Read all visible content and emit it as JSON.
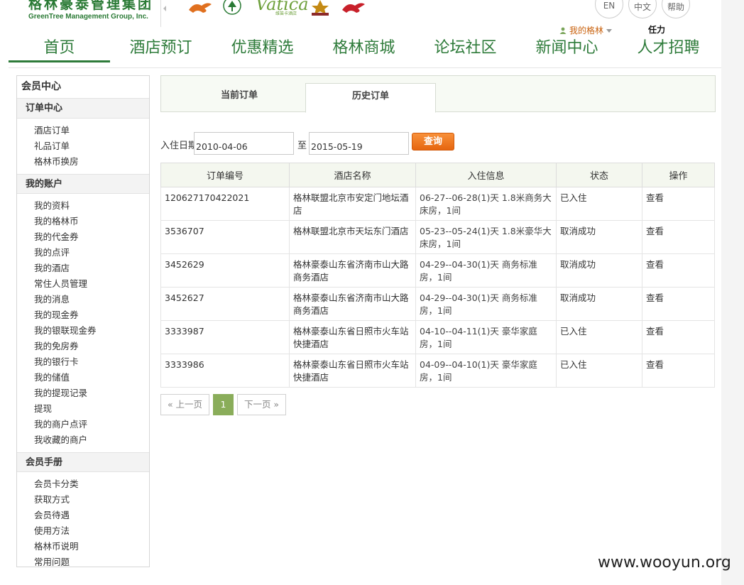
{
  "header": {
    "logo_cn": "格林豪泰管理集团",
    "logo_en": "GreenTree Management Group, Inc.",
    "brand_vatica": "Vatica",
    "brand_vatica_sub": "维笛卡酒店",
    "lang_en": "EN",
    "lang_cn": "中文",
    "help": "帮助",
    "user_menu": "我的格林",
    "user_name": "任力"
  },
  "nav": {
    "items": [
      "首页",
      "酒店预订",
      "优惠精选",
      "格林商城",
      "论坛社区",
      "新闻中心",
      "人才招聘"
    ],
    "active_index": 0
  },
  "sidebar": {
    "title": "会员中心",
    "sections": [
      {
        "title": "订单中心",
        "items": [
          "酒店订单",
          "礼品订单",
          "格林币换房"
        ]
      },
      {
        "title": "我的账户",
        "items": [
          "我的资料",
          "我的格林币",
          "我的代金券",
          "我的点评",
          "我的酒店",
          "常住人员管理",
          "我的消息",
          "我的现金券",
          "我的银联现金券",
          "我的免房券",
          "我的银行卡",
          "我的储值",
          "我的提现记录",
          "提现",
          "我的商户点评",
          "我收藏的商户"
        ]
      },
      {
        "title": "会员手册",
        "items": [
          "会员卡分类",
          "获取方式",
          "会员待遇",
          "使用方法",
          "格林币说明",
          "常用问题"
        ]
      }
    ]
  },
  "tabs": {
    "current": "当前订单",
    "history": "历史订单"
  },
  "filter": {
    "label": "入住日期",
    "from": "2010-04-06",
    "to_label": "至",
    "to": "2015-05-19",
    "search": "查询"
  },
  "table": {
    "headers": [
      "订单编号",
      "酒店名称",
      "入住信息",
      "状态",
      "操作"
    ],
    "rows": [
      [
        "120627170422021",
        "格林联盟北京市安定门地坛酒店",
        "06-27--06-28(1)天 1.8米商务大床房，1间",
        "已入住",
        "查看"
      ],
      [
        "3536707",
        "格林联盟北京市天坛东门酒店",
        "05-23--05-24(1)天 1.8米豪华大床房，1间",
        "取消成功",
        "查看"
      ],
      [
        "3452629",
        "格林豪泰山东省济南市山大路商务酒店",
        "04-29--04-30(1)天 商务标准房，1间",
        "取消成功",
        "查看"
      ],
      [
        "3452627",
        "格林豪泰山东省济南市山大路商务酒店",
        "04-29--04-30(1)天 商务标准房，1间",
        "取消成功",
        "查看"
      ],
      [
        "3333987",
        "格林豪泰山东省日照市火车站快捷酒店",
        "04-10--04-11(1)天 豪华家庭房，1间",
        "已入住",
        "查看"
      ],
      [
        "3333986",
        "格林豪泰山东省日照市火车站快捷酒店",
        "04-09--04-10(1)天 豪华家庭房，1间",
        "已入住",
        "查看"
      ]
    ]
  },
  "pager": {
    "prev": "« 上一页",
    "page": "1",
    "next": "下一页 »"
  },
  "watermark": "www.wooyun.org",
  "colors": {
    "brand_green": "#2e7b3a",
    "accent_orange": "#e6650f",
    "pager_active": "#8aad5a"
  }
}
